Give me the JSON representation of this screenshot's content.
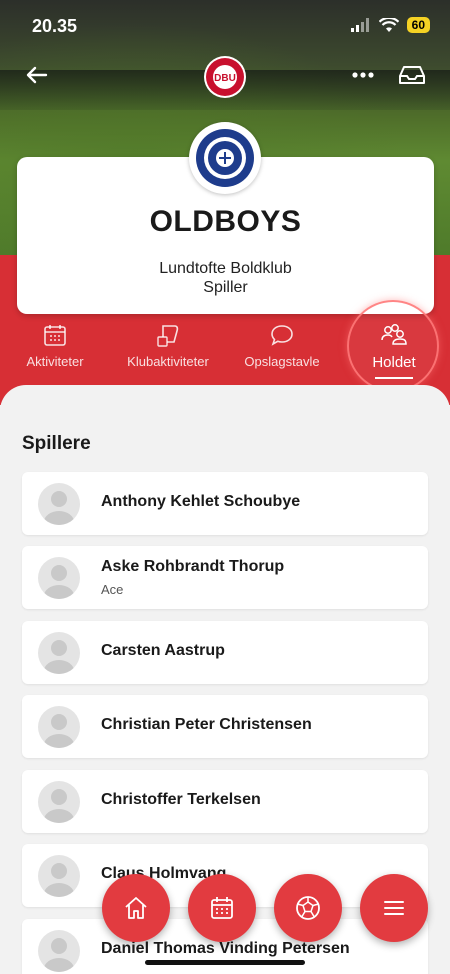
{
  "status_bar": {
    "time": "20.35",
    "battery": "60"
  },
  "logo_text": "DBU",
  "team": {
    "name": "OLDBOYS",
    "club": "Lundtofte Boldklub",
    "role": "Spiller"
  },
  "tabs": [
    {
      "label": "Aktiviteter",
      "icon": "calendar-icon",
      "active": false
    },
    {
      "label": "Klubaktiviteter",
      "icon": "club-calendar-icon",
      "active": false
    },
    {
      "label": "Opslagstavle",
      "icon": "chat-bubble-icon",
      "active": false
    },
    {
      "label": "Holdet",
      "icon": "team-icon",
      "active": true
    }
  ],
  "section_title": "Spillere",
  "players": [
    {
      "name": "Anthony Kehlet Schoubye",
      "sub": ""
    },
    {
      "name": "Aske Rohbrandt Thorup",
      "sub": "Ace"
    },
    {
      "name": "Carsten Aastrup",
      "sub": ""
    },
    {
      "name": "Christian Peter Christensen",
      "sub": ""
    },
    {
      "name": "Christoffer Terkelsen",
      "sub": ""
    },
    {
      "name": "Claus Holmvang",
      "sub": ""
    },
    {
      "name": "Daniel Thomas Vinding Petersen",
      "sub": ""
    }
  ],
  "bottom_nav": [
    "home-icon",
    "calendar-icon",
    "football-icon",
    "menu-icon"
  ],
  "colors": {
    "brand_red": "#d72f35",
    "fab_red": "#e23b40",
    "battery_yellow": "#f5d224"
  }
}
